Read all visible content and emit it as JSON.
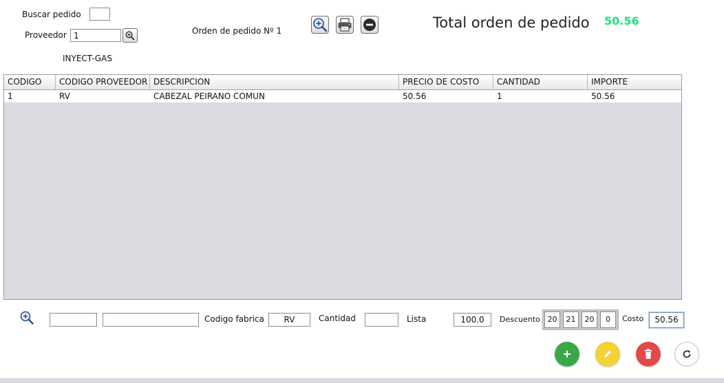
{
  "header": {
    "search_order_label": "Buscar pedido",
    "search_order_value": "",
    "supplier_label": "Proveedor",
    "supplier_value": "1",
    "supplier_name": "INYECT-GAS",
    "order_number_label": "Orden de pedido Nº 1",
    "total_label": "Total orden de pedido",
    "total_value": "50.56",
    "total_color": "#19e57a",
    "toolbar_icons": [
      "zoom-in-icon",
      "printer-icon",
      "minus-circle-icon"
    ]
  },
  "table": {
    "columns": [
      "CODIGO",
      "CODIGO PROVEEDOR",
      "DESCRIPCION",
      "PRECIO DE COSTO",
      "CANTIDAD",
      "IMPORTE"
    ],
    "rows": [
      [
        "1",
        "RV",
        "CABEZAL PEIRANO COMUN",
        "50.56",
        "1",
        "50.56"
      ]
    ]
  },
  "form": {
    "search_icon": "zoom-in-icon",
    "code_value": "",
    "description_value": "",
    "factory_code_label": "Codigo fabrica",
    "factory_code_value": "RV",
    "quantity_label": "Cantidad",
    "quantity_value": "",
    "list_label": "Lista",
    "list_value": "100.0",
    "discount_label": "Descuento",
    "discounts": [
      "20",
      "21",
      "20",
      "0"
    ],
    "cost_label": "Costo",
    "cost_value": "50.56"
  },
  "actions": [
    {
      "name": "add",
      "icon": "plus-icon",
      "color": "#3aa846"
    },
    {
      "name": "edit",
      "icon": "pencil-icon",
      "color": "#f2d235"
    },
    {
      "name": "delete",
      "icon": "trash-icon",
      "color": "#e54848"
    },
    {
      "name": "refresh",
      "icon": "refresh-icon",
      "color": "#ffffff"
    }
  ]
}
